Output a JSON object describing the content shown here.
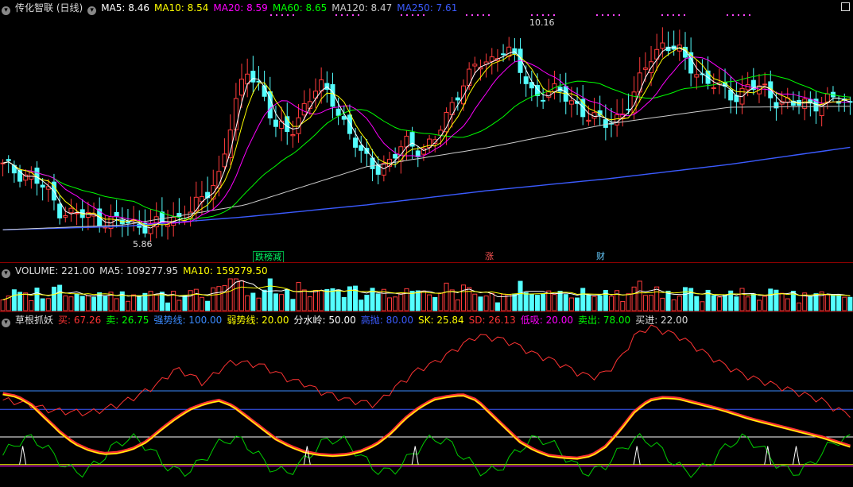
{
  "main": {
    "name": "传化智联 (日线)",
    "ma_items": [
      {
        "label": "MA5: 8.46",
        "color": "#ffffff"
      },
      {
        "label": "MA10: 8.54",
        "color": "#ffff00"
      },
      {
        "label": "MA20: 8.59",
        "color": "#ff00ff"
      },
      {
        "label": "MA60: 8.65",
        "color": "#00ff00"
      },
      {
        "label": "MA120: 8.47",
        "color": "#cccccc"
      },
      {
        "label": "MA250: 7.61",
        "color": "#3b5bff"
      }
    ],
    "high_label": "10.16",
    "low_label": "5.86",
    "tags": [
      {
        "text": "跌榜减",
        "color": "#00ff66"
      },
      {
        "text": "涨",
        "color": "#ff5555"
      },
      {
        "text": "财",
        "color": "#66ccff"
      }
    ]
  },
  "volume": {
    "items": [
      {
        "label": "VOLUME: 221.00",
        "color": "#dddddd"
      },
      {
        "label": "MA5: 109277.95",
        "color": "#dddddd"
      },
      {
        "label": "MA10: 159279.50",
        "color": "#ffff00"
      }
    ]
  },
  "indicator": {
    "items": [
      {
        "label": "草根抓妖",
        "color": "#dddddd"
      },
      {
        "label": "买: 67.26",
        "color": "#ff3333"
      },
      {
        "label": "卖: 26.75",
        "color": "#00ff00"
      },
      {
        "label": "强势线: 100.00",
        "color": "#3b8bff"
      },
      {
        "label": "弱势线: 20.00",
        "color": "#ffff00"
      },
      {
        "label": "分水岭: 50.00",
        "color": "#ffffff"
      },
      {
        "label": "高抛: 80.00",
        "color": "#3b5bff"
      },
      {
        "label": "SK: 25.84",
        "color": "#ffff00"
      },
      {
        "label": "SD: 26.13",
        "color": "#ff3333"
      },
      {
        "label": "低吸: 20.00",
        "color": "#ff00ff"
      },
      {
        "label": "卖出: 78.00",
        "color": "#00ff00"
      },
      {
        "label": "买进: 22.00",
        "color": "#dddddd"
      }
    ]
  },
  "chart_data": {
    "type": "line",
    "price_range": [
      5.5,
      10.4
    ],
    "indicator_range": [
      0,
      100
    ],
    "price_high": 10.16,
    "price_low": 5.86,
    "ma_latest": {
      "MA5": 8.46,
      "MA10": 8.54,
      "MA20": 8.59,
      "MA60": 8.65,
      "MA120": 8.47,
      "MA250": 7.61
    },
    "ma250_series": [
      5.88,
      5.95,
      6.15,
      6.4,
      6.7,
      6.95,
      7.25,
      7.61
    ],
    "ma120_series": [
      5.88,
      5.98,
      6.4,
      7.2,
      7.6,
      8.1,
      8.45,
      8.47
    ],
    "price_close": [
      7.2,
      7.1,
      7.0,
      6.7,
      6.3,
      6.2,
      6.15,
      6.1,
      6.05,
      6.0,
      6.0,
      5.98,
      6.1,
      6.3,
      6.5,
      7.0,
      8.3,
      9.2,
      8.9,
      8.0,
      7.9,
      8.5,
      8.9,
      8.6,
      8.0,
      7.4,
      7.2,
      7.3,
      7.7,
      7.6,
      7.7,
      8.3,
      9.0,
      9.3,
      9.4,
      9.8,
      9.2,
      8.7,
      8.8,
      8.7,
      8.5,
      8.2,
      8.1,
      8.3,
      8.7,
      9.5,
      9.8,
      9.6,
      9.3,
      9.0,
      8.8,
      8.7,
      8.9,
      8.8,
      8.6,
      8.5,
      8.5,
      8.6,
      8.6,
      8.5
    ],
    "sell_line": [
      97,
      94,
      85,
      70,
      55,
      43,
      36,
      32,
      33,
      37,
      45,
      58,
      70,
      80,
      86,
      90,
      84,
      72,
      60,
      48,
      40,
      34,
      31,
      30,
      31,
      35,
      42,
      54,
      70,
      82,
      91,
      94,
      96,
      90,
      75,
      60,
      45,
      36,
      30,
      28,
      27,
      30,
      40,
      58,
      78,
      90,
      93,
      92,
      88,
      84,
      80,
      75,
      70,
      66,
      62,
      58,
      54,
      50,
      45,
      40
    ],
    "buy_line": [
      90,
      88,
      85,
      80,
      78,
      77,
      76,
      80,
      85,
      92,
      100,
      110,
      124,
      118,
      108,
      122,
      132,
      130,
      128,
      120,
      112,
      108,
      100,
      95,
      90,
      88,
      85,
      100,
      112,
      124,
      130,
      140,
      150,
      160,
      158,
      155,
      148,
      140,
      135,
      128,
      120,
      115,
      120,
      135,
      160,
      170,
      165,
      160,
      150,
      140,
      130,
      122,
      115,
      110,
      105,
      100,
      95,
      90,
      80,
      75
    ]
  }
}
